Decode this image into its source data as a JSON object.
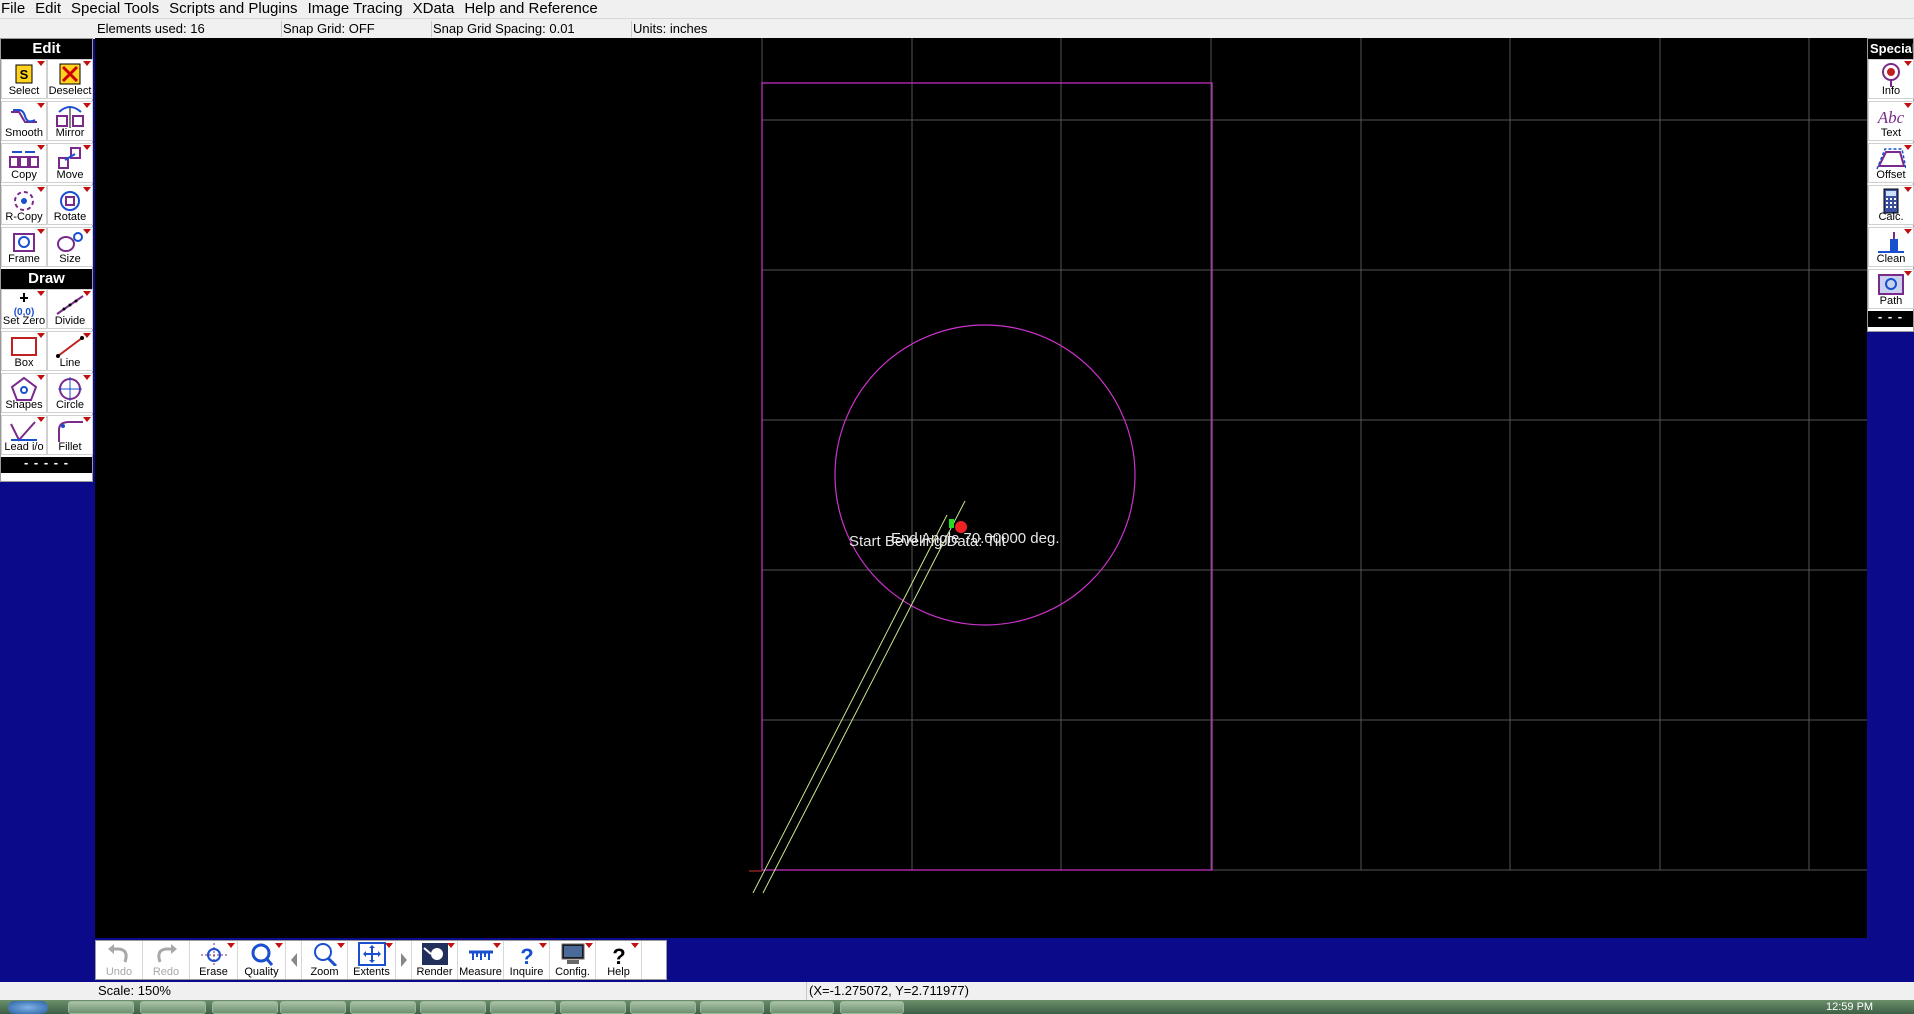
{
  "menu": [
    "File",
    "Edit",
    "Special Tools",
    "Scripts and Plugins",
    "Image Tracing",
    "XData",
    "Help and Reference"
  ],
  "status": {
    "elements_used": "Elements used: 16",
    "snap_grid": "Snap Grid: OFF",
    "snap_spacing": "Snap Grid Spacing: 0.01",
    "units": "Units: inches"
  },
  "left_panel": {
    "edit_header": "Edit",
    "edit_tools": [
      {
        "label": "Select",
        "icon": "select-icon"
      },
      {
        "label": "Deselect",
        "icon": "deselect-icon"
      },
      {
        "label": "Smooth",
        "icon": "smooth-icon"
      },
      {
        "label": "Mirror",
        "icon": "mirror-icon"
      },
      {
        "label": "Copy",
        "icon": "copy-icon"
      },
      {
        "label": "Move",
        "icon": "move-icon"
      },
      {
        "label": "R-Copy",
        "icon": "rotary-copy-icon"
      },
      {
        "label": "Rotate",
        "icon": "rotate-icon"
      },
      {
        "label": "Frame",
        "icon": "frame-icon"
      },
      {
        "label": "Size",
        "icon": "size-icon"
      }
    ],
    "draw_header": "Draw",
    "draw_tools": [
      {
        "label": "Set Zero",
        "icon": "set-zero-icon"
      },
      {
        "label": "Divide",
        "icon": "divide-icon"
      },
      {
        "label": "Box",
        "icon": "box-icon"
      },
      {
        "label": "Line",
        "icon": "line-icon"
      },
      {
        "label": "Shapes",
        "icon": "shapes-icon"
      },
      {
        "label": "Circle",
        "icon": "circle-icon"
      },
      {
        "label": "Lead i/o",
        "icon": "lead-io-icon"
      },
      {
        "label": "Fillet",
        "icon": "fillet-icon"
      }
    ],
    "divider": "- - - - -"
  },
  "right_panel": {
    "header": "Special",
    "tools": [
      {
        "label": "Info",
        "icon": "info-icon"
      },
      {
        "label": "Text",
        "icon": "text-icon"
      },
      {
        "label": "Offset",
        "icon": "offset-icon"
      },
      {
        "label": "Calc.",
        "icon": "calculator-icon"
      },
      {
        "label": "Clean",
        "icon": "clean-icon"
      },
      {
        "label": "Path",
        "icon": "path-icon"
      }
    ],
    "divider": "- - -"
  },
  "canvas": {
    "label_start": "Start Beveling Data: Tilt",
    "label_end": "End Angle 70.00000 deg."
  },
  "bottom_tools": [
    {
      "label": "Undo",
      "icon": "undo-icon",
      "enabled": false
    },
    {
      "label": "Redo",
      "icon": "redo-icon",
      "enabled": false
    },
    {
      "label": "Erase",
      "icon": "erase-icon",
      "enabled": true
    },
    {
      "label": "Quality",
      "icon": "quality-icon",
      "enabled": true
    },
    {
      "label": "Zoom",
      "icon": "zoom-icon",
      "enabled": true
    },
    {
      "label": "Extents",
      "icon": "extents-icon",
      "enabled": true
    },
    {
      "label": "Render",
      "icon": "render-icon",
      "enabled": true
    },
    {
      "label": "Measure",
      "icon": "measure-icon",
      "enabled": true
    },
    {
      "label": "Inquire",
      "icon": "inquire-icon",
      "enabled": true
    },
    {
      "label": "Config.",
      "icon": "config-icon",
      "enabled": true
    },
    {
      "label": "Help",
      "icon": "help-icon",
      "enabled": true
    }
  ],
  "footer": {
    "scale": "Scale: 150%",
    "coords": "(X=-1.275072, Y=2.711977)",
    "clock": "12:59 PM"
  },
  "colors": {
    "canvas_bg": "#000000",
    "grid": "#555555",
    "geometry": "#cc33cc",
    "toolpath": "#c8e890",
    "workspace": "#0a0a8a"
  }
}
